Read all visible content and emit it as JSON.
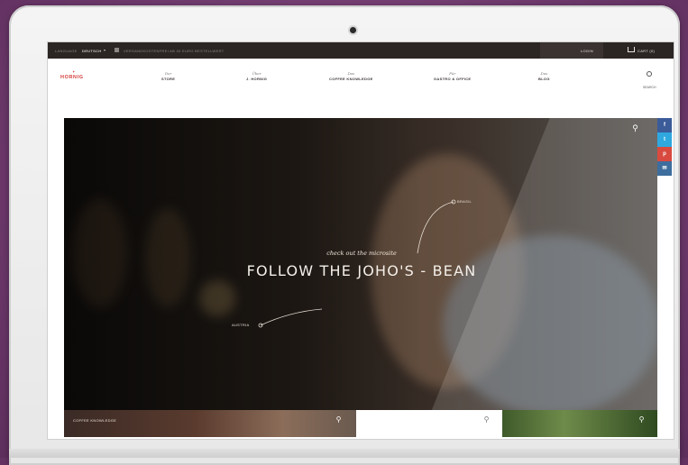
{
  "topbar": {
    "language_label": "LANGUAGE",
    "language_value": "DEUTSCH",
    "promo": "VERSANDKOSTENFREI AB 40 EURO BESTELLWERT",
    "login": "LOGIN",
    "cart": "CART (0)"
  },
  "logo": "HORNIG",
  "nav": [
    {
      "script": "Der",
      "label": "STORE"
    },
    {
      "script": "Über",
      "label": "J. HORNIG"
    },
    {
      "script": "Das",
      "label": "COFFEE KNOWLEDGE"
    },
    {
      "script": "Für",
      "label": "GASTRO & OFFICE"
    },
    {
      "script": "Das",
      "label": "BLOG"
    }
  ],
  "search_label": "SEARCH",
  "hero": {
    "tagline": "check out the microsite",
    "headline": "FOLLOW THE JOHO'S - BEAN",
    "pin_right": "BRASIL",
    "pin_left": "AUSTRIA"
  },
  "strip": {
    "caption": "COFFEE KNOWLEDGE"
  },
  "social": [
    "f",
    "t",
    "p",
    "✉"
  ],
  "colors": {
    "accent": "#d43c3c",
    "topbar": "#2b2524",
    "facebook": "#3b5b99",
    "twitter": "#2fa8e0",
    "pinterest": "#d84a3f",
    "mail": "#3e6e9e"
  }
}
